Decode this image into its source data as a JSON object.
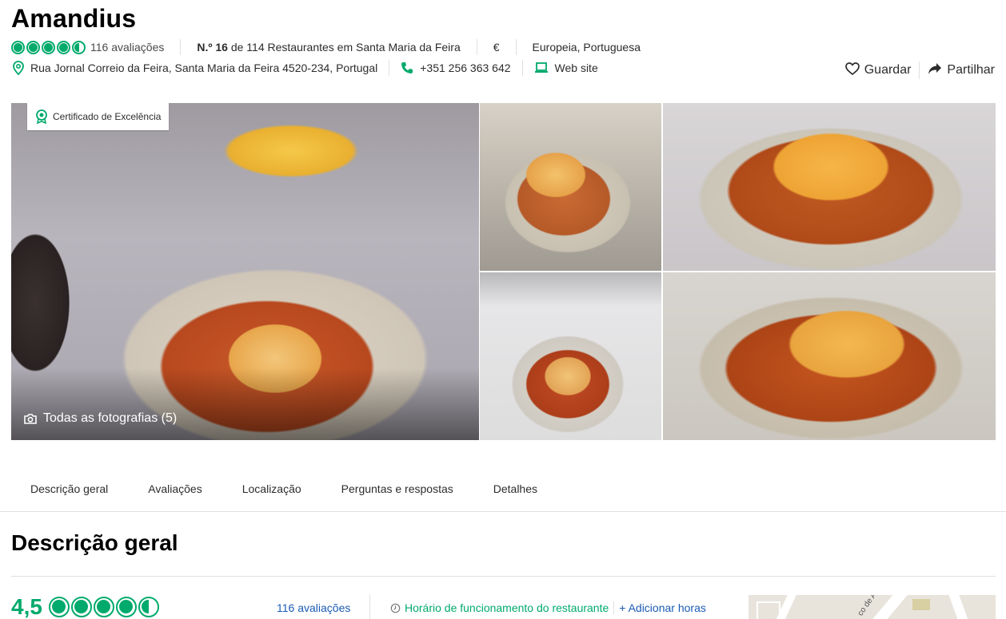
{
  "header": {
    "title": "Amandius",
    "rating_bubbles": 4.5,
    "reviews": "116 avaliações",
    "rank_prefix": "N.º 16",
    "rank_suffix": " de 114 Restaurantes em Santa Maria da Feira",
    "price": "€",
    "cuisines": "Europeia, Portuguesa",
    "address": "Rua Jornal Correio da Feira, Santa Maria da Feira 4520-234, Portugal",
    "phone": "+351 256 363 642",
    "website": "Web site"
  },
  "actions": {
    "save": "Guardar",
    "share": "Partilhar"
  },
  "gallery": {
    "badge": "Certificado de Excelência",
    "all_photos": "Todas as fotografias (5)"
  },
  "tabs": [
    "Descrição geral",
    "Avaliações",
    "Localização",
    "Perguntas e respostas",
    "Detalhes"
  ],
  "overview": {
    "title": "Descrição geral",
    "score": "4,5",
    "reviews": "116 avaliações",
    "hours": "Horário de funcionamento do restaurante",
    "add_hours": "+ Adicionar horas",
    "map_label": "co de A"
  },
  "colors": {
    "brand_green": "#00aa6c",
    "link_blue": "#1a5bb5"
  }
}
